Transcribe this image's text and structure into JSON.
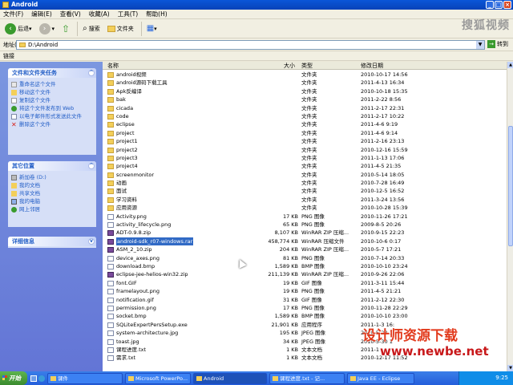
{
  "window": {
    "title": "Android"
  },
  "menu": [
    "文件(F)",
    "编辑(E)",
    "查看(V)",
    "收藏(A)",
    "工具(T)",
    "帮助(H)"
  ],
  "toolbar": {
    "back": "后退",
    "search": "搜索",
    "folders": "文件夹"
  },
  "watermark_top": "搜狐视频",
  "address": {
    "label": "地址(D)",
    "value": "D:\\Android",
    "go": "转到"
  },
  "links": "链接",
  "tasks_panel": {
    "title": "文件和文件夹任务",
    "items": [
      "重命名这个文件",
      "移动这个文件",
      "复制这个文件",
      "将这个文件发布到 Web",
      "以电子邮件形式发送此文件",
      "删除这个文件"
    ]
  },
  "places_panel": {
    "title": "其它位置",
    "items": [
      "新加卷 (D:)",
      "我的文档",
      "共享文档",
      "我的电脑",
      "网上邻居"
    ]
  },
  "details_panel": {
    "title": "详细信息"
  },
  "columns": {
    "name": "名称",
    "size": "大小",
    "type": "类型",
    "modified": "修改日期"
  },
  "files": [
    {
      "name": "android视频",
      "size": "",
      "type": "文件夹",
      "date": "2010-10-17 14:56",
      "kind": "folder"
    },
    {
      "name": "android源码下载工具",
      "size": "",
      "type": "文件夹",
      "date": "2011-4-13 16:34",
      "kind": "folder"
    },
    {
      "name": "Apk反编译",
      "size": "",
      "type": "文件夹",
      "date": "2010-10-18 15:35",
      "kind": "folder"
    },
    {
      "name": "bak",
      "size": "",
      "type": "文件夹",
      "date": "2011-2-22 8:56",
      "kind": "folder"
    },
    {
      "name": "cicada",
      "size": "",
      "type": "文件夹",
      "date": "2011-2-17 22:31",
      "kind": "folder"
    },
    {
      "name": "code",
      "size": "",
      "type": "文件夹",
      "date": "2011-2-17 10:22",
      "kind": "folder"
    },
    {
      "name": "eclipse",
      "size": "",
      "type": "文件夹",
      "date": "2011-4-6 9:19",
      "kind": "folder"
    },
    {
      "name": "project",
      "size": "",
      "type": "文件夹",
      "date": "2011-4-6 9:14",
      "kind": "folder"
    },
    {
      "name": "project1",
      "size": "",
      "type": "文件夹",
      "date": "2011-2-16 23:13",
      "kind": "folder"
    },
    {
      "name": "project2",
      "size": "",
      "type": "文件夹",
      "date": "2010-12-16 15:59",
      "kind": "folder"
    },
    {
      "name": "project3",
      "size": "",
      "type": "文件夹",
      "date": "2011-1-13 17:06",
      "kind": "folder"
    },
    {
      "name": "project4",
      "size": "",
      "type": "文件夹",
      "date": "2011-4-5 21:35",
      "kind": "folder"
    },
    {
      "name": "screenmonitor",
      "size": "",
      "type": "文件夹",
      "date": "2010-5-14 18:05",
      "kind": "folder"
    },
    {
      "name": "动画",
      "size": "",
      "type": "文件夹",
      "date": "2010-7-28 16:49",
      "kind": "folder"
    },
    {
      "name": "面试",
      "size": "",
      "type": "文件夹",
      "date": "2010-12-5 16:52",
      "kind": "folder"
    },
    {
      "name": "学习资料",
      "size": "",
      "type": "文件夹",
      "date": "2011-3-24 13:56",
      "kind": "folder"
    },
    {
      "name": "应用资源",
      "size": "",
      "type": "文件夹",
      "date": "2010-10-28 15:39",
      "kind": "folder"
    },
    {
      "name": "Activity.png",
      "size": "17 KB",
      "type": "PNG 图像",
      "date": "2010-11-26 17:21",
      "kind": "file"
    },
    {
      "name": "activity_lifecycle.png",
      "size": "65 KB",
      "type": "PNG 图像",
      "date": "2009-8-5 20:26",
      "kind": "file"
    },
    {
      "name": "ADT-0.9.8.zip",
      "size": "8,107 KB",
      "type": "WinRAR ZIP 压缩...",
      "date": "2010-9-15 22:23",
      "kind": "rar"
    },
    {
      "name": "android-sdk_r07-windows.rar",
      "size": "458,774 KB",
      "type": "WinRAR 压缩文件",
      "date": "2010-10-6 0:17",
      "kind": "rar",
      "selected": true
    },
    {
      "name": "ASM_2_10.zip",
      "size": "204 KB",
      "type": "WinRAR ZIP 压缩...",
      "date": "2010-5-7 17:21",
      "kind": "rar"
    },
    {
      "name": "device_axes.png",
      "size": "81 KB",
      "type": "PNG 图像",
      "date": "2010-7-14 20:33",
      "kind": "file"
    },
    {
      "name": "download.bmp",
      "size": "1,589 KB",
      "type": "BMP 图像",
      "date": "2010-10-10 23:24",
      "kind": "file"
    },
    {
      "name": "eclipse-jee-helios-win32.zip",
      "size": "211,139 KB",
      "type": "WinRAR ZIP 压缩...",
      "date": "2010-9-26 22:06",
      "kind": "rar"
    },
    {
      "name": "font.GIF",
      "size": "19 KB",
      "type": "GIF 图像",
      "date": "2011-3-11 15:44",
      "kind": "file"
    },
    {
      "name": "framelayout.png",
      "size": "19 KB",
      "type": "PNG 图像",
      "date": "2011-4-5 21:21",
      "kind": "file"
    },
    {
      "name": "notification.gif",
      "size": "31 KB",
      "type": "GIF 图像",
      "date": "2011-2-12 22:30",
      "kind": "file"
    },
    {
      "name": "permission.png",
      "size": "17 KB",
      "type": "PNG 图像",
      "date": "2010-11-28 22:29",
      "kind": "file"
    },
    {
      "name": "socket.bmp",
      "size": "1,589 KB",
      "type": "BMP 图像",
      "date": "2010-10-10 23:00",
      "kind": "file"
    },
    {
      "name": "SQLiteExpertPersSetup.exe",
      "size": "21,901 KB",
      "type": "应用程序",
      "date": "2011-1-3 16:",
      "kind": "file"
    },
    {
      "name": "system-architecture.jpg",
      "size": "195 KB",
      "type": "JPEG 图像",
      "date": "2010-5-23 1",
      "kind": "file"
    },
    {
      "name": "toast.jpg",
      "size": "34 KB",
      "type": "JPEG 图像",
      "date": "2010-5-30 1",
      "kind": "file"
    },
    {
      "name": "课程进度.txt",
      "size": "1 KB",
      "type": "文本文档",
      "date": "2011-1",
      "kind": "file"
    },
    {
      "name": "需求.txt",
      "size": "1 KB",
      "type": "文本文档",
      "date": "2010-12-17 11:52",
      "kind": "file"
    }
  ],
  "watermark_bottom": {
    "line1": "设计师资源下载",
    "line2": "www.newbe.net"
  },
  "taskbar": {
    "start": "开始",
    "tasks": [
      "课件",
      "Microsoft PowerPo...",
      "Android",
      "课程进度.txt - 记...",
      "Java EE - Eclipse"
    ],
    "clock": "9:25"
  }
}
